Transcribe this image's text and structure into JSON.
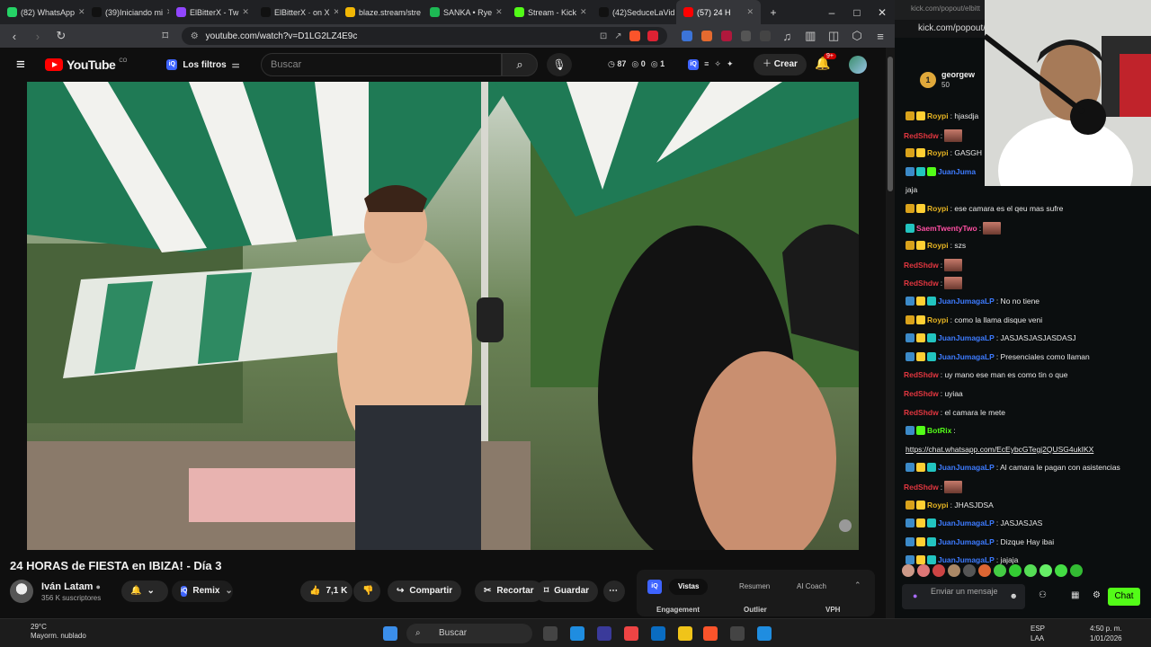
{
  "browser": {
    "tabs": [
      {
        "label": "(82) WhatsApp",
        "color": "#25d366",
        "active": false
      },
      {
        "label": "(39)Iniciando mi",
        "color": "#111111",
        "active": false
      },
      {
        "label": "ElBitterX - Tw",
        "color": "#9146ff",
        "active": false
      },
      {
        "label": "ElBitterX · on X",
        "color": "#111111",
        "active": false
      },
      {
        "label": "blaze.stream/stre",
        "color": "#f2b705",
        "active": false
      },
      {
        "label": "SANKA • Rye",
        "color": "#1db954",
        "active": false
      },
      {
        "label": "Stream - Kick",
        "color": "#53fc18",
        "active": false
      },
      {
        "label": "(42)SeduceLaVid",
        "color": "#111111",
        "active": false
      },
      {
        "label": "(57) 24 H",
        "color": "#ff0000",
        "active": true
      }
    ],
    "new_tab": "+",
    "url": "youtube.com/watch?v=D1LG2LZ4E9c"
  },
  "youtube": {
    "logo_text": "YouTube",
    "logo_country": "CO",
    "filters_label": "Los filtros",
    "search_placeholder": "Buscar",
    "stats": {
      "views": "87",
      "a": "0",
      "b": "1"
    },
    "create_label": "Crear",
    "notif_count": "9+"
  },
  "video": {
    "title": "24 HORAS de FIESTA en IBIZA! - Día 3",
    "channel": "Iván Latam",
    "subscribers": "356 K suscriptores",
    "remix_label": "Remix",
    "likes": "7,1 K",
    "share_label": "Compartir",
    "clip_label": "Recortar",
    "save_label": "Guardar"
  },
  "iq_panel": {
    "tabs": [
      "Vistas",
      "Resumen",
      "AI Coach"
    ],
    "columns": [
      "Engagement",
      "Outlier",
      "VPH"
    ]
  },
  "chat": {
    "url": "kick.com/popout/elbitt",
    "bar_text": "kick.com/popout/",
    "pinned_user": "georgew",
    "pinned_amount": "50",
    "messages": [
      {
        "user": "Roypi",
        "color": "#e6b422",
        "badges": [
          "gold",
          "crown"
        ],
        "text": ": hjasdja",
        "emote": false
      },
      {
        "user": "RedShdw",
        "color": "#e0363f",
        "badges": [],
        "text": ":",
        "emote": true
      },
      {
        "user": "Roypi",
        "color": "#e6b422",
        "badges": [
          "gold",
          "crown"
        ],
        "text": ": GASGH",
        "emote": false
      },
      {
        "user": "JuanJuma",
        "color": "#3d7bff",
        "badges": [
          "blue",
          "teal",
          "green"
        ],
        "text": "",
        "emote": false
      },
      {
        "user": "",
        "color": "#e8e8e8",
        "badges": [],
        "text": "jaja",
        "emote": false
      },
      {
        "user": "Roypi",
        "color": "#e6b422",
        "badges": [
          "gold",
          "crown"
        ],
        "text": ": ese camara es el qeu mas sufre",
        "emote": false
      },
      {
        "user": "SaemTwentyTwo",
        "color": "#ff4fa3",
        "badges": [
          "teal"
        ],
        "text": ":",
        "emote": true
      },
      {
        "user": "Roypi",
        "color": "#e6b422",
        "badges": [
          "gold",
          "crown"
        ],
        "text": ": szs",
        "emote": false
      },
      {
        "user": "RedShdw",
        "color": "#e0363f",
        "badges": [],
        "text": ":",
        "emote": true
      },
      {
        "user": "RedShdw",
        "color": "#e0363f",
        "badges": [],
        "text": ":",
        "emote": true
      },
      {
        "user": "JuanJumagaLP",
        "color": "#3d7bff",
        "badges": [
          "blue",
          "crown",
          "teal"
        ],
        "text": ": No no tiene",
        "emote": false
      },
      {
        "user": "Roypi",
        "color": "#e6b422",
        "badges": [
          "gold",
          "crown"
        ],
        "text": ": como la llama disque veni",
        "emote": false
      },
      {
        "user": "JuanJumagaLP",
        "color": "#3d7bff",
        "badges": [
          "blue",
          "crown",
          "teal"
        ],
        "text": ": JASJASJASJASDASJ",
        "emote": false
      },
      {
        "user": "JuanJumagaLP",
        "color": "#3d7bff",
        "badges": [
          "blue",
          "crown",
          "teal"
        ],
        "text": ": Presenciales como llaman",
        "emote": false
      },
      {
        "user": "RedShdw",
        "color": "#e0363f",
        "badges": [],
        "text": ": uy mano ese man es como tin o que",
        "emote": false
      },
      {
        "user": "RedShdw",
        "color": "#e0363f",
        "badges": [],
        "text": ": uyiaa",
        "emote": false
      },
      {
        "user": "RedShdw",
        "color": "#e0363f",
        "badges": [],
        "text": ": el camara le mete",
        "emote": false
      },
      {
        "user": "BotRix",
        "color": "#53fc18",
        "badges": [
          "blue",
          "green"
        ],
        "text": ":",
        "emote": false
      },
      {
        "user": "",
        "color": "#e8e8e8",
        "badges": [],
        "text": "https://chat.whatsapp.com/EcEybcGTegj2QUSG4ukIKX",
        "emote": false,
        "link": true
      },
      {
        "user": "JuanJumagaLP",
        "color": "#3d7bff",
        "badges": [
          "blue",
          "crown",
          "teal"
        ],
        "text": ": Al camara le pagan con asistencias",
        "emote": false
      },
      {
        "user": "RedShdw",
        "color": "#e0363f",
        "badges": [],
        "text": ":",
        "emote": true
      },
      {
        "user": "Roypi",
        "color": "#e6b422",
        "badges": [
          "gold",
          "crown"
        ],
        "text": ": JHASJDSA",
        "emote": false
      },
      {
        "user": "JuanJumagaLP",
        "color": "#3d7bff",
        "badges": [
          "blue",
          "crown",
          "teal"
        ],
        "text": ": JASJASJAS",
        "emote": false
      },
      {
        "user": "JuanJumagaLP",
        "color": "#3d7bff",
        "badges": [
          "blue",
          "crown",
          "teal"
        ],
        "text": ": Dizque Hay ibai",
        "emote": false
      },
      {
        "user": "JuanJumagaLP",
        "color": "#3d7bff",
        "badges": [
          "blue",
          "crown",
          "teal"
        ],
        "text": ": jajaja",
        "emote": false
      }
    ],
    "input_placeholder": "Enviar un mensaje",
    "send_label": "Chat"
  },
  "taskbar": {
    "temperature": "29°C",
    "weather": "Mayorm. nublado",
    "search_label": "Buscar",
    "lang_top": "ESP",
    "lang_bottom": "LAA",
    "time": "4:50 p. m.",
    "date": "1/01/2026"
  }
}
